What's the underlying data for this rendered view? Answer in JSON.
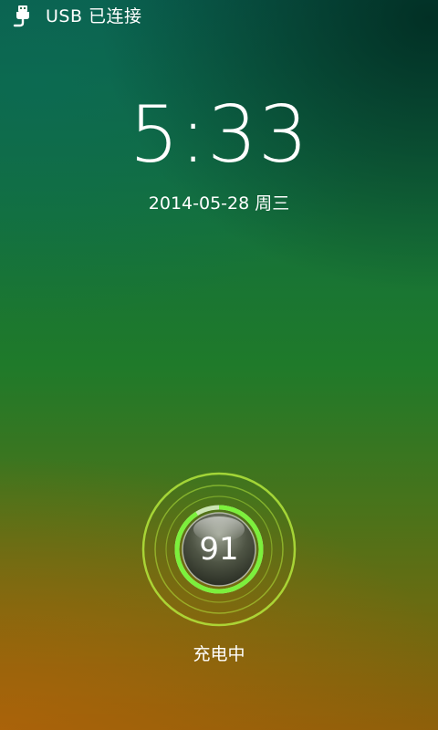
{
  "status_bar": {
    "usb_icon": "usb-icon",
    "usb_text": "USB 已连接"
  },
  "clock": {
    "time": "5:33",
    "date": "2014-05-28 周三"
  },
  "charging": {
    "level": "91",
    "level_fraction": 0.91,
    "status": "充电中",
    "ring_color": "#7cf03c",
    "outer_ring_color": "#a8e83a"
  }
}
